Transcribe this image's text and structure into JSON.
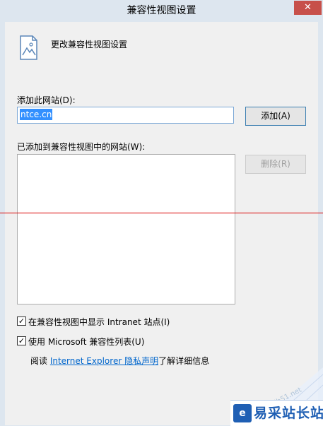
{
  "window": {
    "title": "兼容性视图设置",
    "close_symbol": "✕"
  },
  "header": {
    "icon": "broken-image-page-icon",
    "text": "更改兼容性视图设置"
  },
  "add_section": {
    "label": "添加此网站(D):",
    "input_value": "ntce.cn",
    "add_button": "添加(A)"
  },
  "list_section": {
    "label": "已添加到兼容性视图中的网站(W):",
    "sites": [],
    "remove_button": "删除(R)"
  },
  "options": {
    "show_intranet": {
      "label": "在兼容性视图中显示 Intranet 站点(I)",
      "checked": true
    },
    "use_ms_list": {
      "label": "使用 Microsoft 兼容性列表(U)",
      "checked": true
    }
  },
  "privacy": {
    "prefix": "阅读 ",
    "link": "Internet Explorer 隐私声明",
    "suffix": "了解详细信息"
  },
  "watermark": {
    "brand": "易采站长站",
    "icon_glyph": "e",
    "url": "jb51.net"
  },
  "colors": {
    "accent": "#3390ff",
    "close": "#c7504a",
    "link": "#0066cc",
    "guide_line": "#d80000"
  }
}
